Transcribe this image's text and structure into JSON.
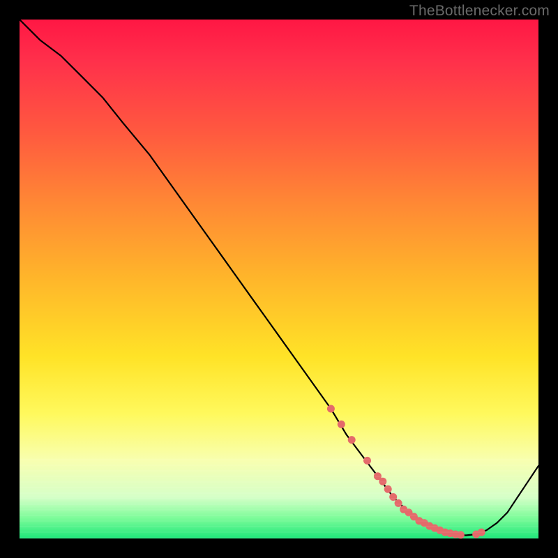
{
  "watermark": "TheBottlenecker.com",
  "colors": {
    "background": "#000000",
    "gradient_top": "#ff1744",
    "gradient_bottom": "#1ee77a",
    "curve": "#000000",
    "marker": "#e46a6a"
  },
  "chart_data": {
    "type": "line",
    "title": "",
    "xlabel": "",
    "ylabel": "",
    "xlim": [
      0,
      100
    ],
    "ylim": [
      0,
      100
    ],
    "series": [
      {
        "name": "bottleneck-curve",
        "x": [
          0,
          4,
          8,
          12,
          16,
          20,
          25,
          30,
          35,
          40,
          45,
          50,
          55,
          60,
          63,
          66,
          69,
          72,
          75,
          78,
          80,
          82,
          84,
          86,
          88,
          90,
          92,
          94,
          96,
          98,
          100
        ],
        "values": [
          100,
          96,
          93,
          89,
          85,
          80,
          74,
          67,
          60,
          53,
          46,
          39,
          32,
          25,
          20,
          16,
          12,
          8,
          5,
          3,
          2,
          1.2,
          0.8,
          0.6,
          0.8,
          1.6,
          3,
          5,
          8,
          11,
          14
        ]
      }
    ],
    "markers": {
      "name": "highlight-points",
      "x": [
        60,
        62,
        64,
        67,
        69,
        70,
        71,
        72,
        73,
        74,
        75,
        76,
        77,
        78,
        79,
        80,
        81,
        82,
        83,
        84,
        85,
        88,
        89
      ],
      "values": [
        25,
        22,
        19,
        15,
        12,
        11,
        9.5,
        8,
        6.8,
        5.6,
        5,
        4.2,
        3.4,
        3,
        2.4,
        2,
        1.6,
        1.2,
        1,
        0.8,
        0.7,
        0.8,
        1.2
      ]
    }
  }
}
